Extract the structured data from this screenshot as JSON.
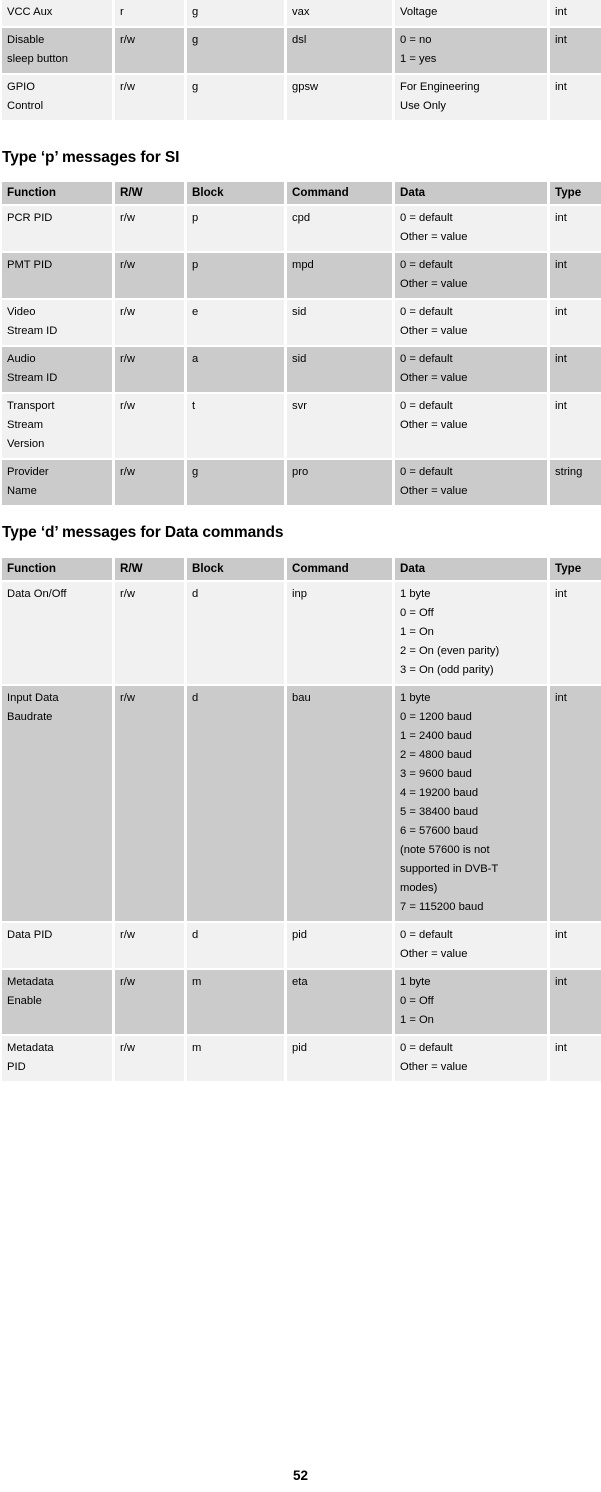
{
  "document": {
    "page_number": "52"
  },
  "columns": [
    "Function",
    "R/W",
    "Block",
    "Command",
    "Data",
    "Type"
  ],
  "tables": [
    {
      "id": "continued-table",
      "heading": null,
      "show_header": false,
      "rows": [
        {
          "shade": "light",
          "function": [
            "VCC Aux"
          ],
          "rw": "r",
          "block": "g",
          "command": "vax",
          "data": [
            "Voltage"
          ],
          "type": "int"
        },
        {
          "shade": "dark",
          "function": [
            "Disable",
            "sleep button"
          ],
          "rw": "r/w",
          "block": "g",
          "command": "dsl",
          "data": [
            "0 = no",
            "1 = yes"
          ],
          "type": "int"
        },
        {
          "shade": "light",
          "function": [
            "GPIO",
            "Control"
          ],
          "rw": "r/w",
          "block": "g",
          "command": "gpsw",
          "data": [
            "For Engineering",
            "Use Only"
          ],
          "type": "int"
        }
      ]
    },
    {
      "id": "p-messages-table",
      "heading": "Type ‘p’ messages for SI",
      "show_header": true,
      "rows": [
        {
          "shade": "light",
          "function": [
            "PCR PID"
          ],
          "rw": "r/w",
          "block": "p",
          "command": "cpd",
          "data": [
            "0 = default",
            "Other = value"
          ],
          "type": "int"
        },
        {
          "shade": "dark",
          "function": [
            "PMT PID"
          ],
          "rw": "r/w",
          "block": "p",
          "command": "mpd",
          "data": [
            "0 = default",
            "Other = value"
          ],
          "type": "int"
        },
        {
          "shade": "light",
          "function": [
            "Video",
            "Stream ID"
          ],
          "rw": "r/w",
          "block": "e",
          "command": "sid",
          "data": [
            "0 = default",
            "Other = value"
          ],
          "type": "int"
        },
        {
          "shade": "dark",
          "function": [
            "Audio",
            "Stream ID"
          ],
          "rw": "r/w",
          "block": "a",
          "command": "sid",
          "data": [
            "0 = default",
            "Other = value"
          ],
          "type": "int"
        },
        {
          "shade": "light",
          "function": [
            "Transport",
            "Stream",
            "Version"
          ],
          "rw": "r/w",
          "block": "t",
          "command": "svr",
          "data": [
            "0 = default",
            "Other = value"
          ],
          "type": "int"
        },
        {
          "shade": "dark",
          "function": [
            "Provider",
            "Name"
          ],
          "rw": "r/w",
          "block": "g",
          "command": "pro",
          "data": [
            "0 = default",
            "Other = value"
          ],
          "type": "string"
        }
      ]
    },
    {
      "id": "d-messages-table",
      "heading": "Type ‘d’ messages for Data commands",
      "show_header": true,
      "rows": [
        {
          "shade": "light",
          "function": [
            "Data On/Off"
          ],
          "rw": "r/w",
          "block": "d",
          "command": "inp",
          "data": [
            "1 byte",
            "0 = Off",
            "1 = On",
            "2 = On (even parity)",
            "3 = On (odd parity)"
          ],
          "type": "int"
        },
        {
          "shade": "dark",
          "function": [
            "Input Data",
            "Baudrate"
          ],
          "rw": "r/w",
          "block": "d",
          "command": "bau",
          "data": [
            "1 byte",
            "0 = 1200 baud",
            "1 = 2400 baud",
            "2 = 4800 baud",
            "3 = 9600 baud",
            "4 = 19200 baud",
            "5 = 38400 baud",
            "6 = 57600 baud",
            "(note 57600 is not",
            "supported in DVB-T",
            "modes)",
            "7 = 115200 baud"
          ],
          "type": "int"
        },
        {
          "shade": "light",
          "function": [
            "Data PID"
          ],
          "rw": "r/w",
          "block": "d",
          "command": "pid",
          "data": [
            "0 = default",
            "Other = value"
          ],
          "type": "int"
        },
        {
          "shade": "dark",
          "function": [
            "Metadata",
            "Enable"
          ],
          "rw": "r/w",
          "block": "m",
          "command": "eta",
          "data": [
            "1 byte",
            "0 = Off",
            "1 = On"
          ],
          "type": "int"
        },
        {
          "shade": "light",
          "function": [
            "Metadata",
            "PID"
          ],
          "rw": "r/w",
          "block": "m",
          "command": "pid",
          "data": [
            "0 = default",
            "Other = value"
          ],
          "type": "int"
        }
      ]
    }
  ]
}
